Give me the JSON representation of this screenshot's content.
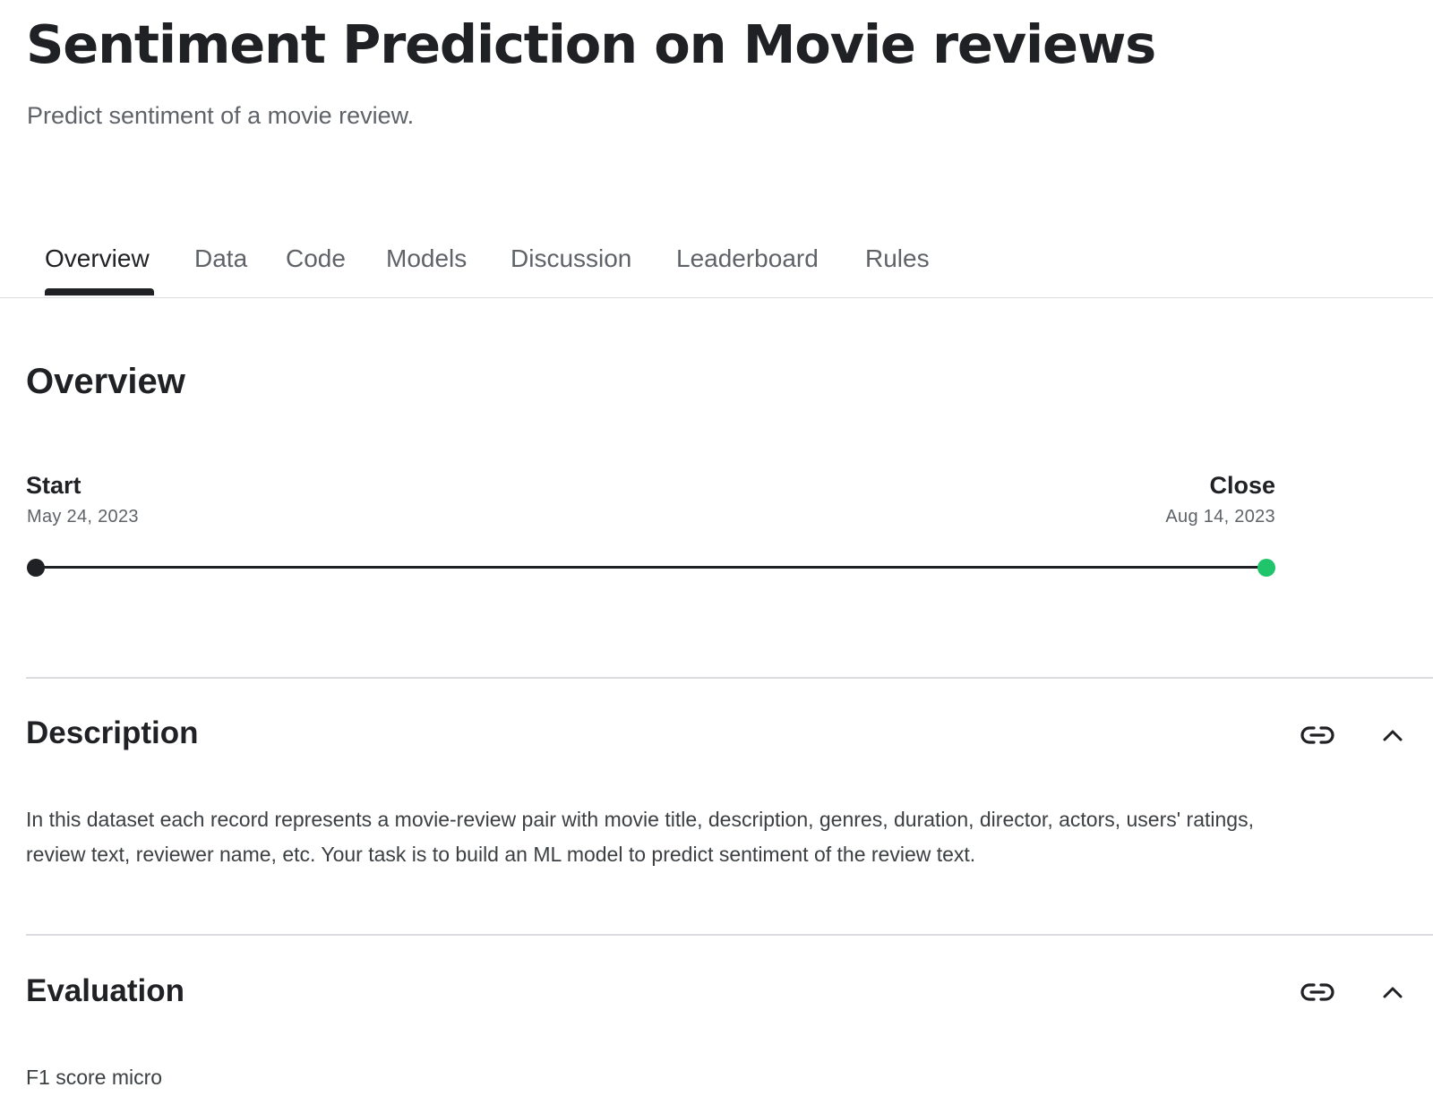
{
  "header": {
    "title": "Sentiment Prediction on Movie reviews",
    "subtitle": "Predict sentiment of a movie review."
  },
  "tabs": [
    {
      "label": "Overview",
      "active": true
    },
    {
      "label": "Data",
      "active": false
    },
    {
      "label": "Code",
      "active": false
    },
    {
      "label": "Models",
      "active": false
    },
    {
      "label": "Discussion",
      "active": false
    },
    {
      "label": "Leaderboard",
      "active": false
    },
    {
      "label": "Rules",
      "active": false
    }
  ],
  "overview": {
    "heading": "Overview",
    "timeline": {
      "start_label": "Start",
      "start_date": "May 24, 2023",
      "close_label": "Close",
      "close_date": "Aug 14, 2023",
      "progress": 1.0
    }
  },
  "sections": {
    "description": {
      "heading": "Description",
      "text": "In this dataset each record represents a movie-review pair with movie title, description, genres, duration, director, actors, users' ratings, review text, reviewer name, etc. Your task is to build an ML model to predict sentiment of the review text.",
      "expanded": true
    },
    "evaluation": {
      "heading": "Evaluation",
      "text": "F1 score micro",
      "expanded": true
    }
  },
  "icons": {
    "link": "link-icon",
    "collapse": "chevron-up-icon"
  },
  "colors": {
    "text_primary": "#202124",
    "text_secondary": "#5f6368",
    "timeline_end": "#20c56b",
    "divider": "#dadce0"
  }
}
